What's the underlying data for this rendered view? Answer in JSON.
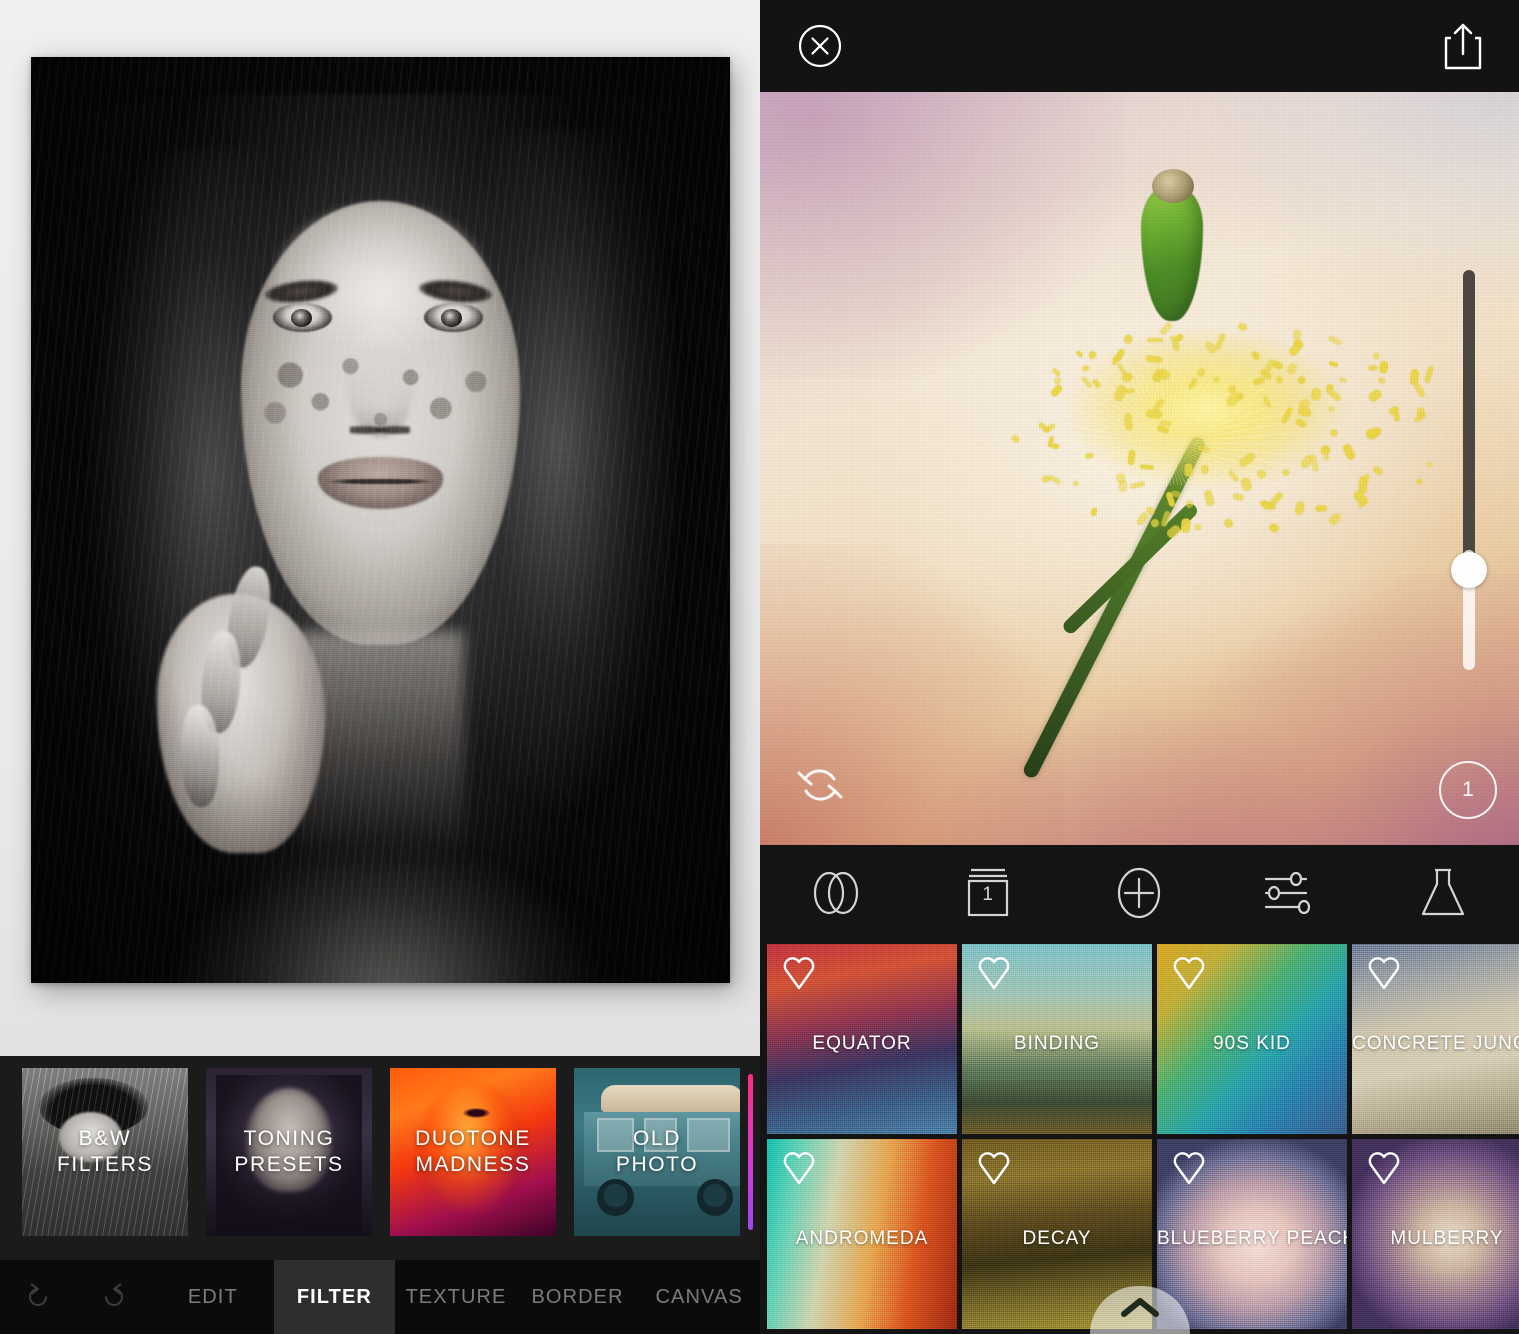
{
  "left": {
    "photo": {
      "alt": "black and white portrait of a young woman with freckles, hand on chin"
    },
    "presets": [
      {
        "label": "B&W\nFILTERS",
        "art": "a-bw"
      },
      {
        "label": "TONING\nPRESETS",
        "art": "a-toning"
      },
      {
        "label": "DUOTONE\nMADNESS",
        "art": "a-duotone"
      },
      {
        "label": "OLD\nPHOTO",
        "art": "a-oldphoto"
      }
    ],
    "scrollbar_colors": [
      "#ff2e7e",
      "#d43bd6",
      "#9b46ef"
    ],
    "history": {
      "undo": "undo-icon",
      "redo": "redo-icon"
    },
    "tabs": [
      {
        "label": "EDIT",
        "active": false
      },
      {
        "label": "FILTER",
        "active": true
      },
      {
        "label": "TEXTURE",
        "active": false
      },
      {
        "label": "BORDER",
        "active": false
      },
      {
        "label": "CANVAS",
        "active": false
      }
    ]
  },
  "right": {
    "topbar": {
      "close": "close-icon",
      "share": "share-icon"
    },
    "photo": {
      "alt": "yellow flower with exploding pollen on textured warm background"
    },
    "slider": {
      "value": 70,
      "orientation": "vertical"
    },
    "reset_label": "reset-icon",
    "layer_badge": "1",
    "toolbar": [
      {
        "name": "blend-modes-icon",
        "label": ""
      },
      {
        "name": "layers-icon",
        "label": "1"
      },
      {
        "name": "add-icon",
        "label": ""
      },
      {
        "name": "adjustments-icon",
        "label": ""
      },
      {
        "name": "lab-flask-icon",
        "label": ""
      }
    ],
    "filters": [
      {
        "label": "EQUATOR",
        "art": "t-equator",
        "favorite": false
      },
      {
        "label": "BINDING",
        "art": "t-binding",
        "favorite": false
      },
      {
        "label": "90S KID",
        "art": "t-90skid",
        "favorite": false
      },
      {
        "label": "CONCRETE JUNGLE",
        "art": "t-concrete",
        "favorite": false
      },
      {
        "label": "ANDROMEDA",
        "art": "t-andromeda",
        "favorite": false
      },
      {
        "label": "DECAY",
        "art": "t-decay",
        "favorite": false
      },
      {
        "label": "BLUEBERRY PEACH",
        "art": "t-blueberry",
        "favorite": false
      },
      {
        "label": "MULBERRY",
        "art": "t-mulberry",
        "favorite": false
      }
    ],
    "expander": "chevron-up-icon"
  }
}
